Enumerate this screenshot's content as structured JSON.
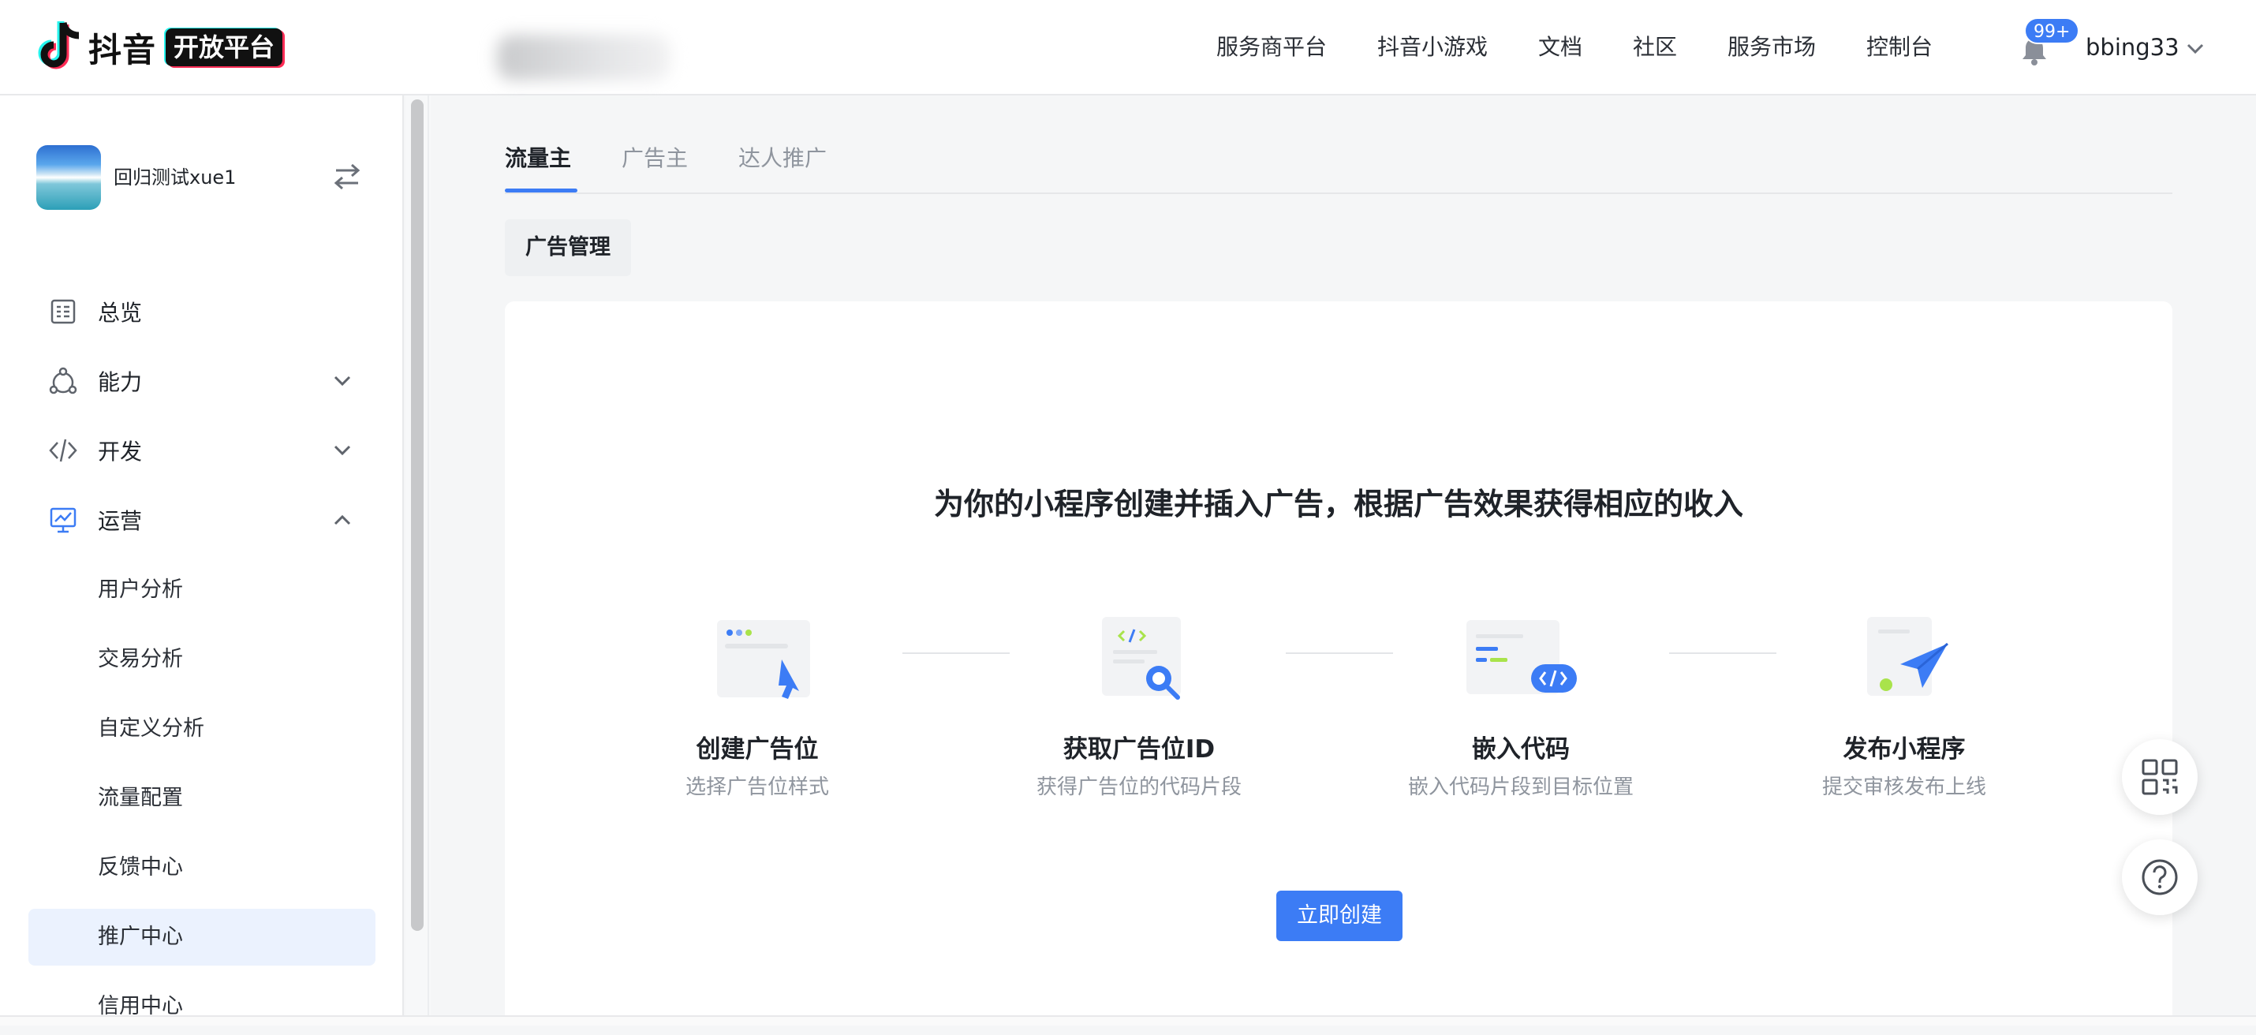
{
  "brand": {
    "logo_text": "抖音",
    "logo_badge": "开放平台"
  },
  "topnav": {
    "items": [
      "服务商平台",
      "抖音小游戏",
      "文档",
      "社区",
      "服务市场",
      "控制台"
    ],
    "notification_count": "99+",
    "username": "bbing33"
  },
  "sidebar": {
    "app_name": "回归测试xue1",
    "menu": [
      {
        "label": "总览",
        "icon": "overview-icon"
      },
      {
        "label": "能力",
        "icon": "capability-icon",
        "expanded": false
      },
      {
        "label": "开发",
        "icon": "code-icon",
        "expanded": false
      },
      {
        "label": "运营",
        "icon": "operation-chart-icon",
        "expanded": true
      }
    ],
    "submenu": [
      {
        "label": "用户分析"
      },
      {
        "label": "交易分析"
      },
      {
        "label": "自定义分析"
      },
      {
        "label": "流量配置"
      },
      {
        "label": "反馈中心"
      },
      {
        "label": "推广中心",
        "active": true
      },
      {
        "label": "信用中心"
      }
    ]
  },
  "main": {
    "tabs": [
      {
        "label": "流量主",
        "active": true
      },
      {
        "label": "广告主"
      },
      {
        "label": "达人推广"
      }
    ],
    "section_pill": "广告管理",
    "headline": "为你的小程序创建并插入广告，根据广告效果获得相应的收入",
    "steps": [
      {
        "title": "创建广告位",
        "desc": "选择广告位样式",
        "icon": "create-ad-slot-icon"
      },
      {
        "title": "获取广告位ID",
        "desc": "获得广告位的代码片段",
        "icon": "get-ad-id-icon"
      },
      {
        "title": "嵌入代码",
        "desc": "嵌入代码片段到目标位置",
        "icon": "embed-code-icon"
      },
      {
        "title": "发布小程序",
        "desc": "提交审核发布上线",
        "icon": "publish-icon"
      }
    ],
    "create_button": "立即创建"
  },
  "colors": {
    "accent": "#3c7cf5",
    "active_bg": "#ebf2fe",
    "muted_text": "#8f959e",
    "brand_green": "#a9e34b"
  }
}
